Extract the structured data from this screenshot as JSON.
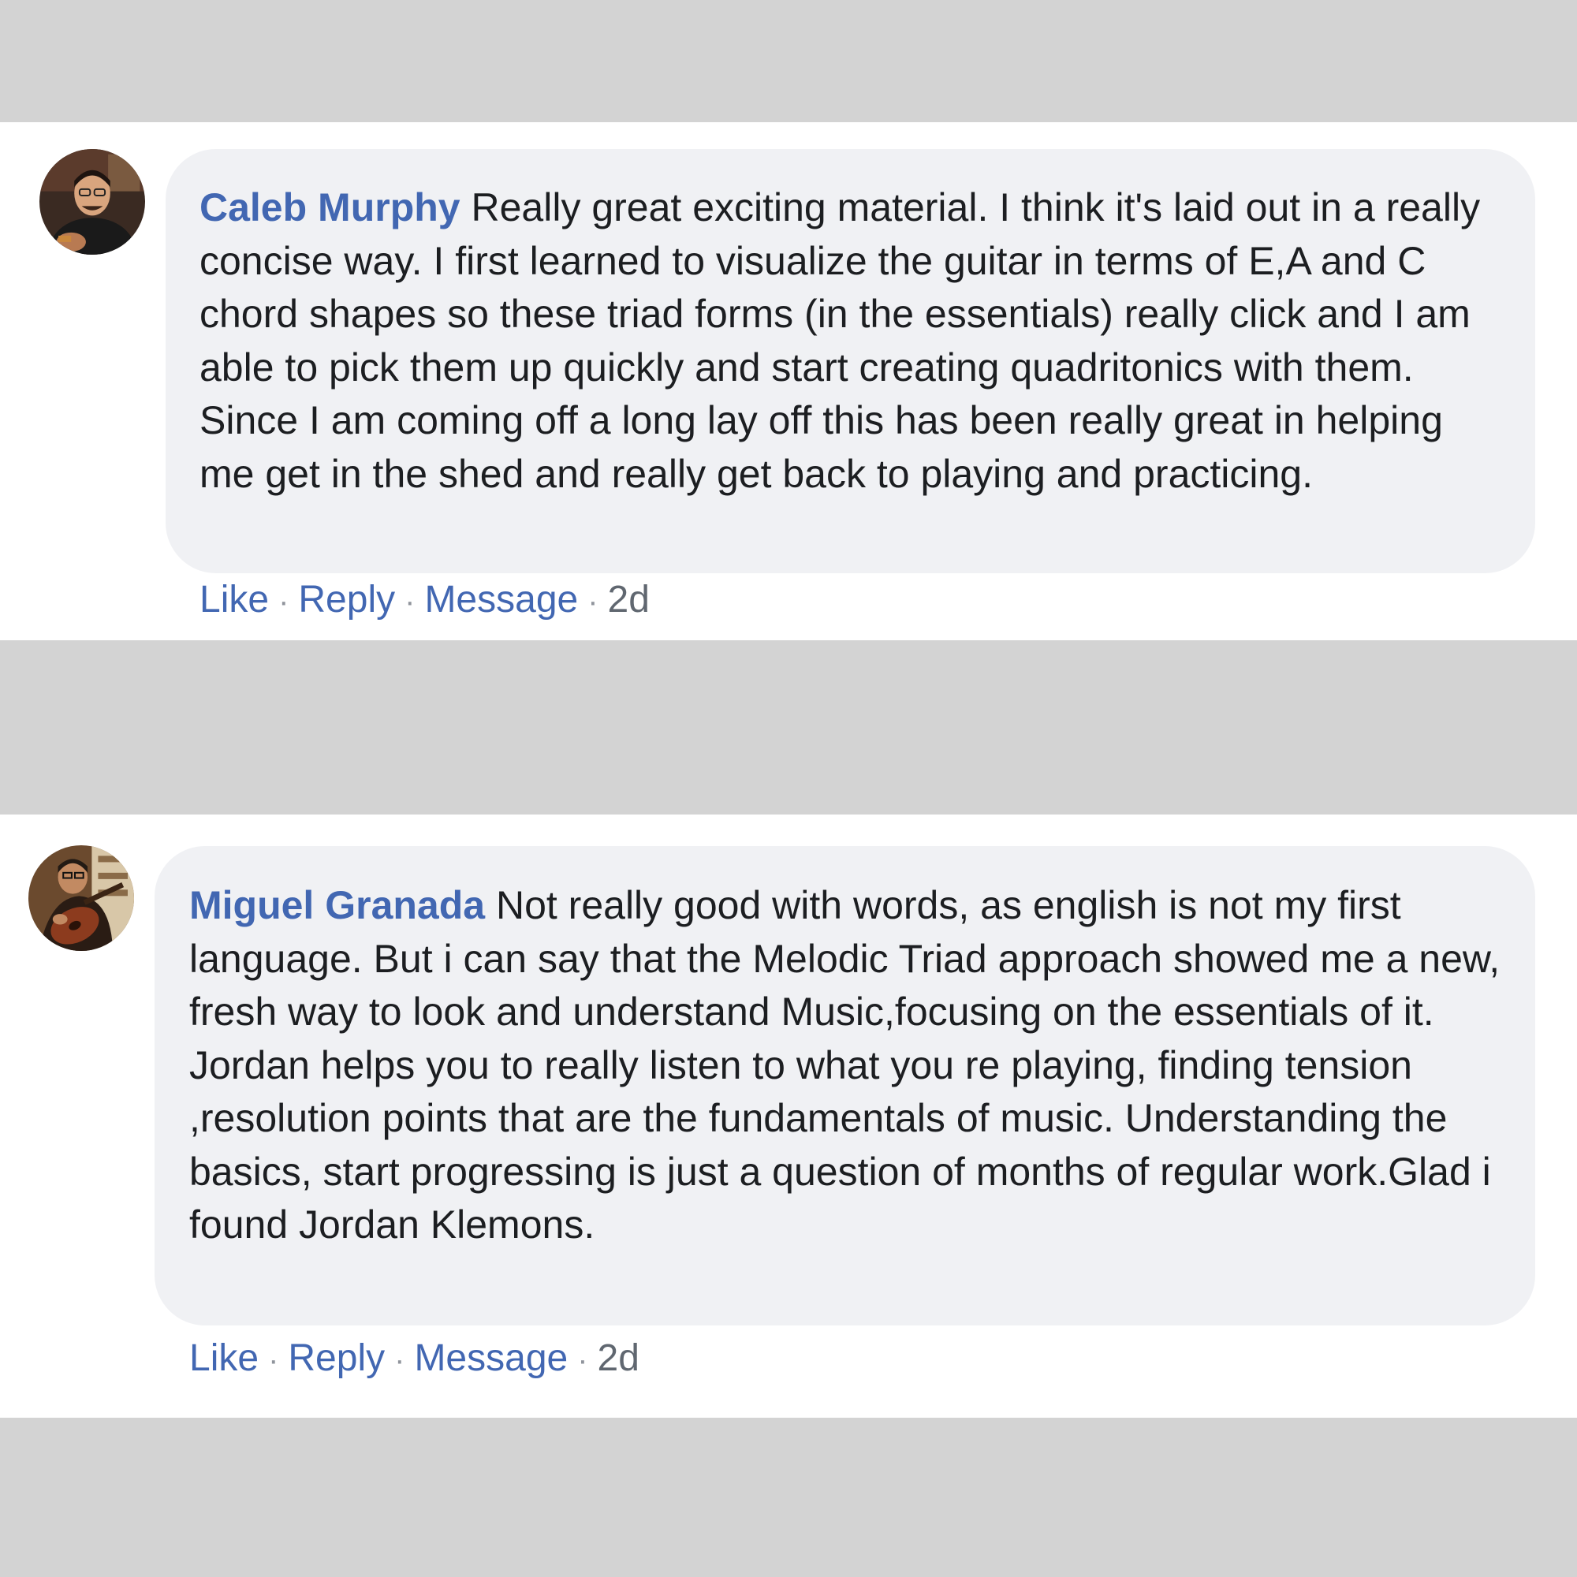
{
  "comments": [
    {
      "author": "Caleb Murphy",
      "text": "Really great exciting material. I think it's laid out in a really concise way. I first learned to visualize the guitar in terms of E,A and C chord shapes so these triad forms (in the essentials) really click and I am able to pick them up quickly and start creating quadritonics with them. Since I am coming off a long lay off this has been really great in helping me get in the shed and really get back to playing and practicing.",
      "actions": {
        "like": "Like",
        "reply": "Reply",
        "message": "Message",
        "separator": "·",
        "time": "2d"
      }
    },
    {
      "author": "Miguel Granada",
      "text": "Not really good with words, as english is not my first language. But i can say that the Melodic Triad approach showed me a new, fresh way to look and understand Music,focusing on the essentials of it. Jordan helps you to really listen to what you re playing, finding tension ,resolution points that are the fundamentals of music. Understanding the basics, start progressing is just a question of months of regular work.Glad i found Jordan Klemons.",
      "actions": {
        "like": "Like",
        "reply": "Reply",
        "message": "Message",
        "separator": "·",
        "time": "2d"
      }
    }
  ],
  "colors": {
    "page_background": "#d3d3d3",
    "panel_background": "#ffffff",
    "bubble_background": "#f0f1f4",
    "author_link": "#4267b2",
    "body_text": "#1c1e21",
    "meta_text": "#606770"
  },
  "icons": {
    "avatar_1": "user-photo-icon",
    "avatar_2": "user-photo-guitar-icon"
  }
}
